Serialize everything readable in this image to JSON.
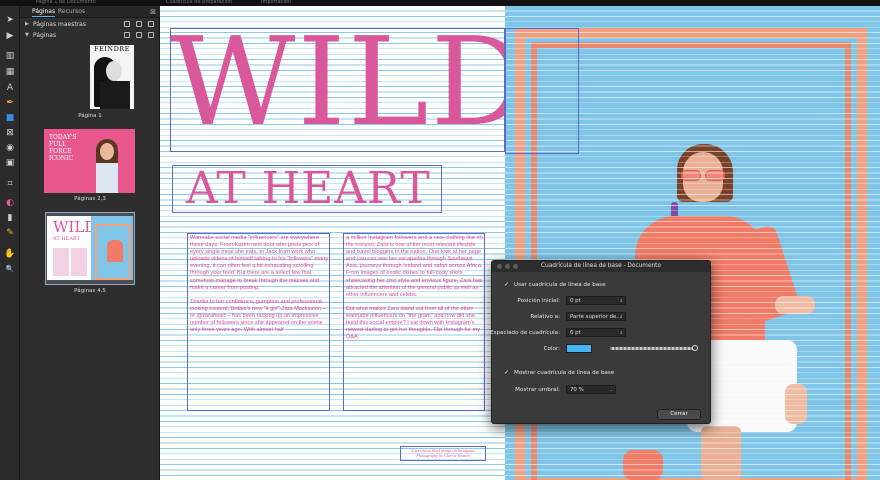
{
  "window": {
    "tabs": [
      "Página 1 de Documento",
      "Cuadrícula de preparación",
      "Importación"
    ]
  },
  "tools": [
    {
      "name": "move-tool-icon",
      "glyph": "➤"
    },
    {
      "name": "play-icon",
      "glyph": "▶"
    },
    {
      "name": "frame-text-tool-icon",
      "glyph": "▥"
    },
    {
      "name": "table-tool-icon",
      "glyph": "▦"
    },
    {
      "name": "artistic-text-tool-icon",
      "glyph": "A"
    },
    {
      "name": "pen-tool-icon",
      "glyph": "✒"
    },
    {
      "name": "rectangle-tool-icon",
      "glyph": "■"
    },
    {
      "name": "picture-frame-tool-icon",
      "glyph": "⊠"
    },
    {
      "name": "ellipse-tool-icon",
      "glyph": "◉"
    },
    {
      "name": "image-tool-icon",
      "glyph": "▣"
    },
    {
      "name": "crop-tool-icon",
      "glyph": "⌗"
    },
    {
      "name": "color-picker-icon",
      "glyph": "◐"
    },
    {
      "name": "fill-tool-icon",
      "glyph": "▮"
    },
    {
      "name": "pencil-tool-icon",
      "glyph": "✎"
    },
    {
      "name": "hand-tool-icon",
      "glyph": "✋"
    },
    {
      "name": "zoom-tool-icon",
      "glyph": "🔍"
    }
  ],
  "panel": {
    "tabs": [
      "Páginas",
      "Recursos"
    ],
    "close_glyph": "⊠",
    "masters_label": "Páginas maestras",
    "pages_label": "Páginas",
    "thumbs": [
      {
        "label": "Página 1",
        "mag_title": "FEINDRE"
      },
      {
        "label": "Páginas 2,3",
        "text": "TODAY'S FULL FORCE ICONIC"
      },
      {
        "label": "Páginas 4,5",
        "title": "WILD",
        "subtitle": "AT HEART"
      }
    ]
  },
  "spread": {
    "title": "WILD",
    "subtitle": "AT HEART",
    "col1": [
      "Wannabe social media \"influencers\" are everywhere these days. From Karen next door who posts pics of every single meal she eats, to Jack from work who uploads videos of himself talking to his \"followers\" every evening, it can often feel a bit exhausting scrolling through your feed. But there are a select few that somehow manage to break through the masses and make a career from posting.",
      "Thanks to her confidence, gumption and professional-looking content, Britain's new \"it girl\" Zara Mackinnon – or @zaraheart – has been racking up an impressive number of followers since she appeared on the scene only three years ago. With almost half"
    ],
    "col2": [
      "a million Instagram followers and a new clothing line on the horizon, Zara is one of the most relevant lifestyle and travel bloggers in the nation. One look at her page and you can see her escapades through Southeast Asia, journeys through Iceland and safari across Africa. From images of exotic dishes to full-body shots showcasing her chic style and envious figure, Zara has attracted the attention of the general public as well as other influencers and celebs.",
      "But what makes Zara stand out from all of the other wannabe influencers on \"the gram\" and how did she build this social empire? I sat down with Instagram's newest darling to get her thoughts. Flip through for my Q&A"
    ],
    "caption_line1": "Zara's most liked image on Instagram",
    "caption_line2": "Photography by Clarrie Watson"
  },
  "dialog": {
    "title": "Cuadrícula de línea de base - Documento",
    "use_grid_label": "Usar cuadrícula de línea de base",
    "start_label": "Posición inicial:",
    "start_value": "0 pt",
    "relative_label": "Relativo a:",
    "relative_value": "Parte superior de...",
    "spacing_label": "Espaciado de cuadrícula:",
    "spacing_value": "6 pt",
    "color_label": "Color:",
    "color_hex": "#45b4f5",
    "show_grid_label": "Mostrar cuadrícula de línea de base",
    "threshold_label": "Mostrar umbral:",
    "threshold_value": "70 %",
    "close_label": "Cerrar",
    "check_glyph": "✓",
    "spin_glyph": "⇕",
    "dropdown_glyph": "⌄"
  }
}
